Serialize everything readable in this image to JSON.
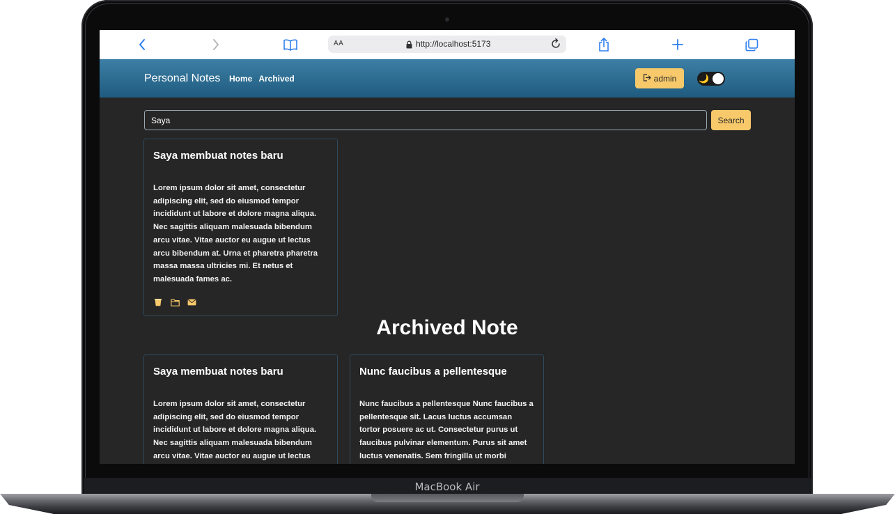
{
  "device": {
    "label": "MacBook Air"
  },
  "browser": {
    "text_size_label": "AA",
    "url": "http://localhost:5173"
  },
  "header": {
    "brand": "Personal Notes",
    "nav": [
      "Home",
      "Archived"
    ],
    "user_button": "admin",
    "theme_icon": "moon-icon"
  },
  "search": {
    "value": "Saya",
    "button": "Search"
  },
  "active_notes": [
    {
      "title": "Saya membuat notes baru",
      "body": "Lorem ipsum dolor sit amet, consectetur adipiscing elit, sed do eiusmod tempor incididunt ut labore et dolore magna aliqua. Nec sagittis aliquam malesuada bibendum arcu vitae. Vitae auctor eu augue ut lectus arcu bibendum at. Urna et pharetra pharetra massa massa ultricies mi. Et netus et malesuada fames ac.",
      "actions": [
        "delete-icon",
        "folder-icon",
        "mail-icon"
      ]
    }
  ],
  "archived_section": {
    "title": "Archived Note",
    "notes": [
      {
        "title": "Saya membuat notes baru",
        "body": "Lorem ipsum dolor sit amet, consectetur adipiscing elit, sed do eiusmod tempor incididunt ut labore et dolore magna aliqua. Nec sagittis aliquam malesuada bibendum arcu vitae. Vitae auctor eu augue ut lectus arcu bibendum at. Urna et pharetra pharetra"
      },
      {
        "title": "Nunc faucibus a pellentesque",
        "body": "Nunc faucibus a pellentesque Nunc faucibus a pellentesque sit. Lacus luctus accumsan tortor posuere ac ut. Consectetur purus ut faucibus pulvinar elementum. Purus sit amet luctus venenatis. Sem fringilla ut morbi tincidunt augue. Amet consectetur adipiscing"
      }
    ]
  },
  "colors": {
    "accent": "#f8c96a",
    "header_top": "#3d7fa5",
    "header_bottom": "#1f5b7f",
    "background": "#262626"
  }
}
